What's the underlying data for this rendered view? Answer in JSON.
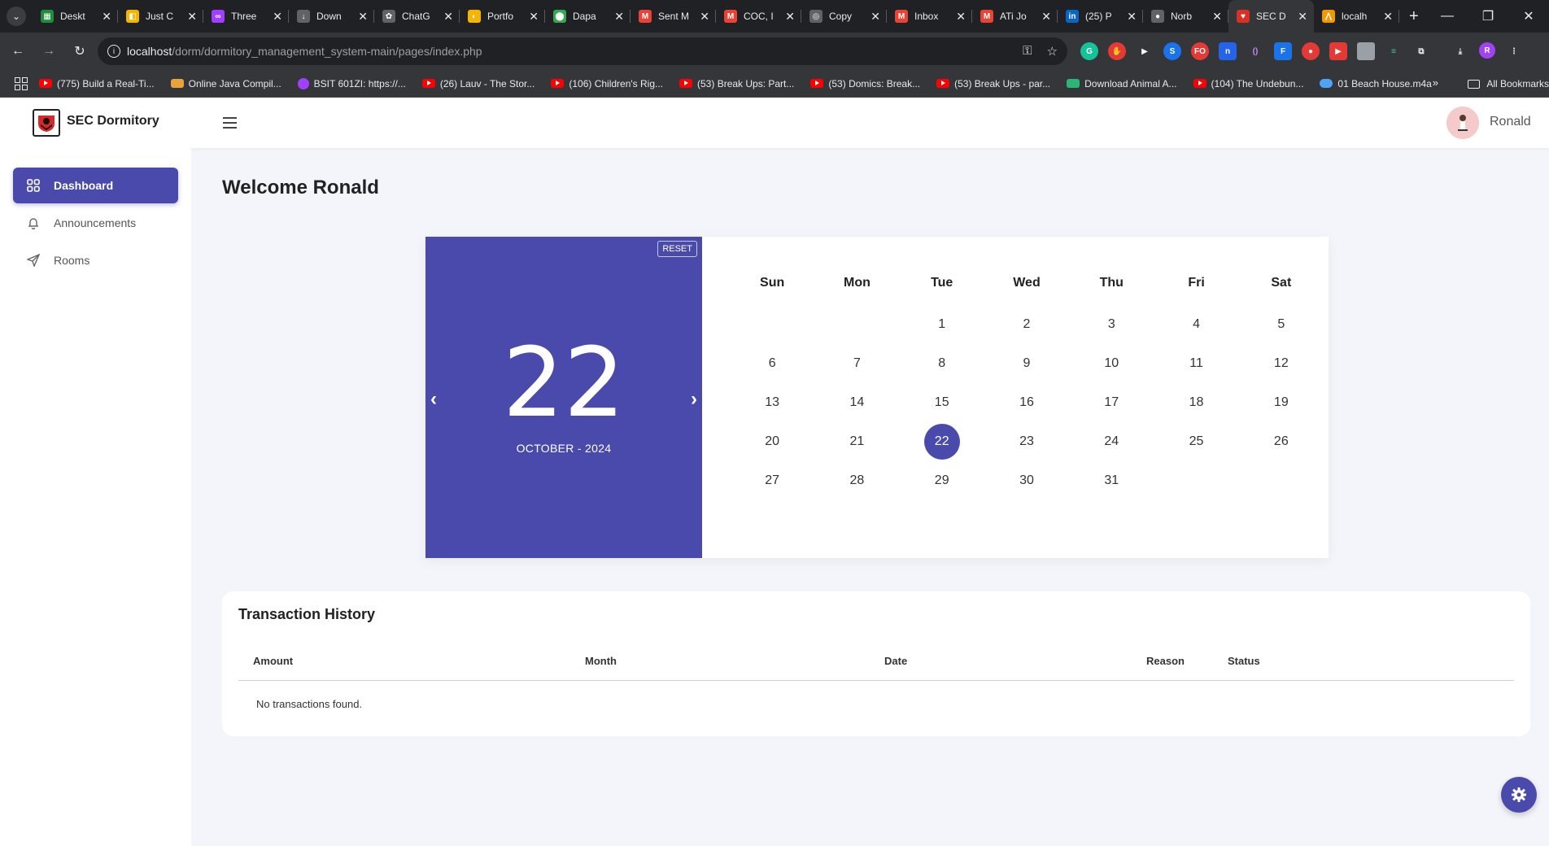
{
  "browser": {
    "tabs": [
      {
        "label": "Deskt",
        "color": "#1e8e3e",
        "glyph": "▦"
      },
      {
        "label": "Just C",
        "color": "#f4b400",
        "glyph": "◧"
      },
      {
        "label": "Three",
        "color": "#a040ff",
        "glyph": "∞"
      },
      {
        "label": "Down",
        "color": "#5f6368",
        "glyph": "↓"
      },
      {
        "label": "ChatG",
        "color": "#5f6368",
        "glyph": "✿"
      },
      {
        "label": "Portfo",
        "color": "#f4b400",
        "glyph": "◐"
      },
      {
        "label": "Dapa",
        "color": "#34a853",
        "glyph": "⬤"
      },
      {
        "label": "Sent M",
        "color": "#ea4335",
        "glyph": "M"
      },
      {
        "label": "COC, I",
        "color": "#ea4335",
        "glyph": "M"
      },
      {
        "label": "Copy",
        "color": "#5f6368",
        "glyph": "◎"
      },
      {
        "label": "Inbox",
        "color": "#ea4335",
        "glyph": "M"
      },
      {
        "label": "ATi Jo",
        "color": "#ea4335",
        "glyph": "M"
      },
      {
        "label": "(25) P",
        "color": "#0a66c2",
        "glyph": "in"
      },
      {
        "label": "Norb",
        "color": "#5f6368",
        "glyph": "●"
      },
      {
        "label": "SEC D",
        "color": "#d93025",
        "glyph": "♥",
        "active": true
      },
      {
        "label": "localh",
        "color": "#f29900",
        "glyph": "⋀"
      }
    ],
    "address": {
      "host": "localhost",
      "path": "/dorm/dormitory_management_system-main/pages/index.php"
    },
    "bookmarks": [
      {
        "label": "(775) Build a Real-Ti...",
        "type": "yt"
      },
      {
        "label": "Online Java Compil...",
        "type": "alt"
      },
      {
        "label": "BSIT 601ZI: https://...",
        "type": "msg"
      },
      {
        "label": "(26) Lauv - The Stor...",
        "type": "yt"
      },
      {
        "label": "(106) Children's Rig...",
        "type": "yt"
      },
      {
        "label": "(53) Break Ups: Part...",
        "type": "yt"
      },
      {
        "label": "(53) Domics: Break...",
        "type": "yt"
      },
      {
        "label": "(53) Break Ups - par...",
        "type": "yt"
      },
      {
        "label": "Download Animal A...",
        "type": "dl"
      },
      {
        "label": "(104) The Undebun...",
        "type": "yt"
      },
      {
        "label": "01 Beach House.m4a",
        "type": "cloud"
      }
    ],
    "bookmarks_more": "»",
    "all_bookmarks": "All Bookmarks"
  },
  "header": {
    "brand": "SEC Dormitory",
    "username": "Ronald"
  },
  "sidebar": {
    "items": [
      {
        "label": "Dashboard",
        "icon": "grid-icon",
        "active": true
      },
      {
        "label": "Announcements",
        "icon": "bell-icon"
      },
      {
        "label": "Rooms",
        "icon": "send-icon"
      }
    ]
  },
  "main": {
    "welcome": "Welcome Ronald",
    "calendar": {
      "reset_label": "RESET",
      "selected_day": "22",
      "month_year": "OCTOBER - 2024",
      "weekdays": [
        "Sun",
        "Mon",
        "Tue",
        "Wed",
        "Thu",
        "Fri",
        "Sat"
      ],
      "weeks": [
        [
          "",
          "",
          "1",
          "2",
          "3",
          "4",
          "5"
        ],
        [
          "6",
          "7",
          "8",
          "9",
          "10",
          "11",
          "12"
        ],
        [
          "13",
          "14",
          "15",
          "16",
          "17",
          "18",
          "19"
        ],
        [
          "20",
          "21",
          "22",
          "23",
          "24",
          "25",
          "26"
        ],
        [
          "27",
          "28",
          "29",
          "30",
          "31",
          "",
          ""
        ]
      ],
      "today": "22",
      "accent": "#4a4aad"
    },
    "transactions": {
      "title": "Transaction History",
      "columns": [
        "Amount",
        "Month",
        "Date",
        "Reason",
        "Status"
      ],
      "empty_message": "No transactions found."
    }
  }
}
